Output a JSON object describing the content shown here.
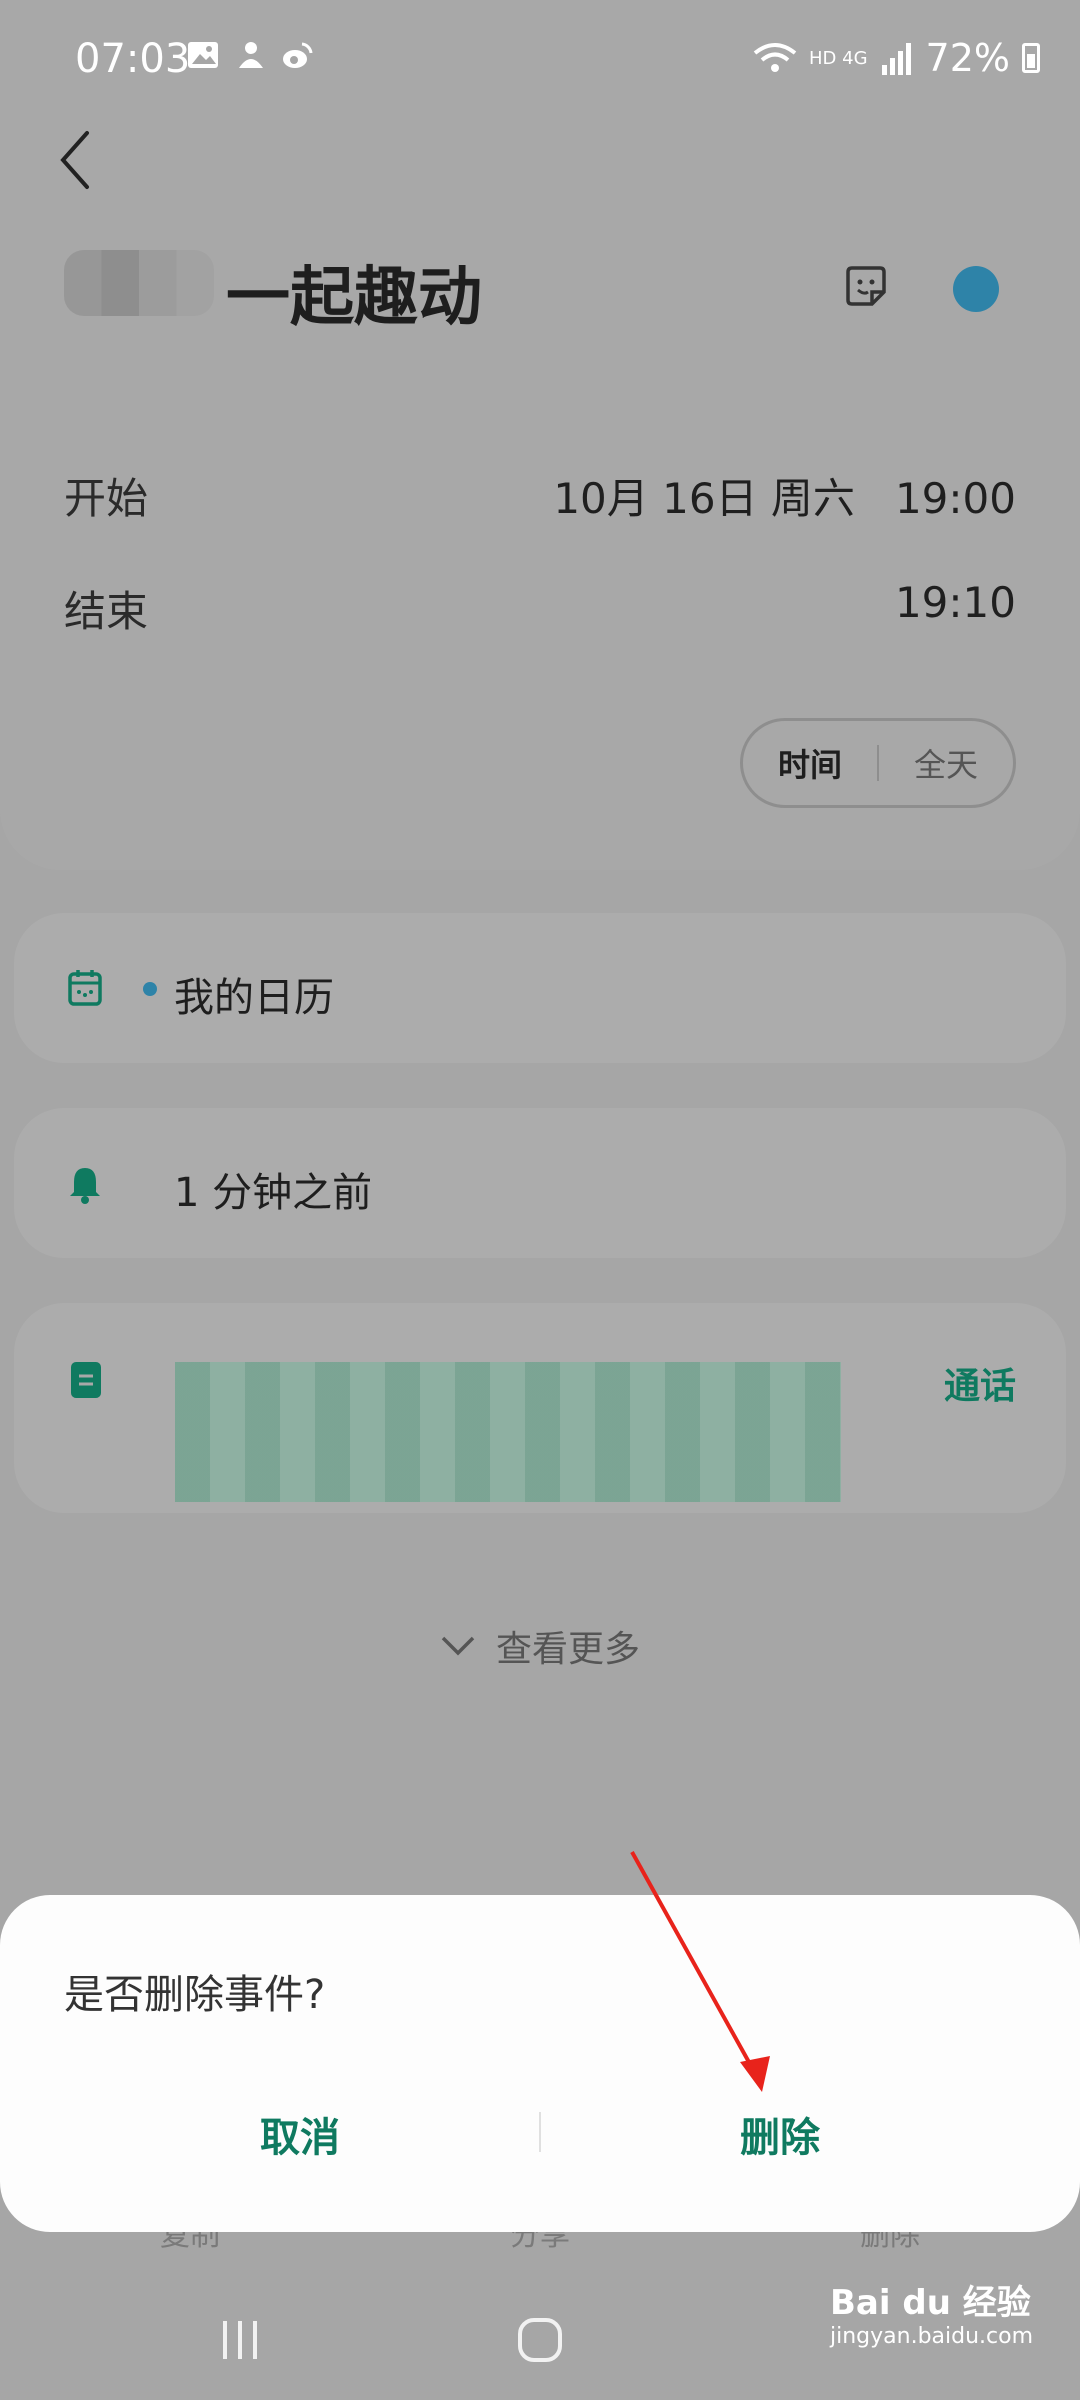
{
  "status_bar": {
    "time": "07:03",
    "battery": "72%",
    "network": "HD 4G"
  },
  "event": {
    "title": "一起趣动",
    "start_label": "开始",
    "start_value": "10月 16日 周六   19:00",
    "end_label": "结束",
    "end_value": "19:10",
    "mode_time": "时间",
    "mode_allday": "全天",
    "calendar_name": "我的日历",
    "reminder": "1 分钟之前",
    "note_action": "通话",
    "view_more": "查看更多"
  },
  "dialog": {
    "question": "是否删除事件?",
    "cancel": "取消",
    "delete": "删除"
  },
  "bottom_actions_behind": [
    "复制",
    "分享",
    "删除"
  ],
  "watermark": {
    "brand": "Bai du 经验",
    "url": "jingyan.baidu.com"
  },
  "colors": {
    "accent": "#0f7a60",
    "calendar_dot": "#2e83a8",
    "arrow": "#e8231b"
  }
}
